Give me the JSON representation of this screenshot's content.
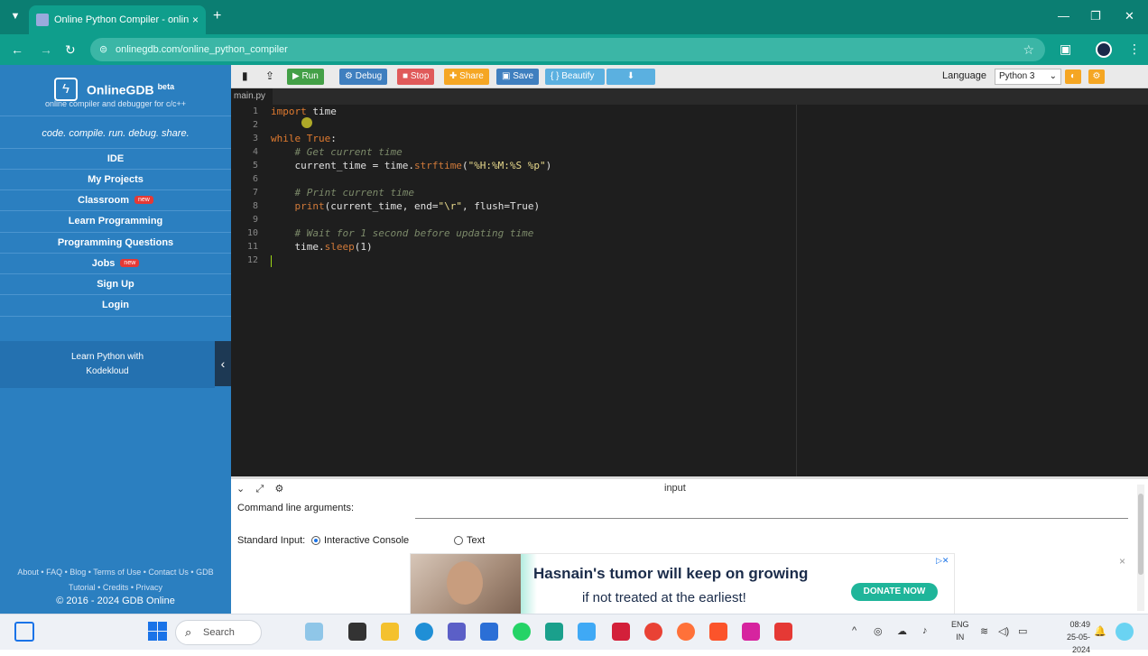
{
  "browser": {
    "tab_title": "Online Python Compiler - onlin",
    "tab_close": "×",
    "new_tab": "+",
    "url": "onlinegdb.com/online_python_compiler",
    "window_controls": [
      "—",
      "❐",
      "✕"
    ]
  },
  "sidebar": {
    "brand_name": "OnlineGDB",
    "brand_sup": "beta",
    "tagline": "online compiler and debugger for c/c++",
    "motto": "code. compile. run. debug. share.",
    "nav": [
      {
        "label": "IDE",
        "new": false
      },
      {
        "label": "My Projects",
        "new": false
      },
      {
        "label": "Classroom",
        "new": true
      },
      {
        "label": "Learn Programming",
        "new": false
      },
      {
        "label": "Programming Questions",
        "new": false
      },
      {
        "label": "Jobs",
        "new": true
      },
      {
        "label": "Sign Up",
        "new": false
      },
      {
        "label": "Login",
        "new": false
      }
    ],
    "new_badge": "new",
    "promo_line1": "Learn Python with",
    "promo_line2": "Kodekloud",
    "footer_line1": "About • FAQ • Blog • Terms of Use • Contact Us • GDB",
    "footer_line2": "Tutorial • Credits • Privacy",
    "copyright": "© 2016 - 2024 GDB Online"
  },
  "toolbar": {
    "run": "Run",
    "debug": "Debug",
    "stop": "Stop",
    "share": "Share",
    "save": "Save",
    "beautify": "{ } Beautify",
    "language_label": "Language",
    "language_value": "Python 3",
    "colors": {
      "run": "#43a047",
      "debug": "#3f7fbf",
      "stop": "#e05a5a",
      "share": "#f5a623",
      "save": "#3f7fbf",
      "beautify": "#5bb0e0",
      "download": "#5bb0e0"
    }
  },
  "editor": {
    "filename": "main.py",
    "line_numbers": [
      "1",
      "2",
      "3",
      "4",
      "5",
      "6",
      "7",
      "8",
      "9",
      "10",
      "11",
      "12"
    ],
    "lines": [
      {
        "k": "import",
        "r": " time"
      },
      {
        "r": ""
      },
      {
        "k": "while",
        "r": " ",
        "c": "True",
        "e": ":"
      },
      {
        "cm": "    # Get current time"
      },
      {
        "r": "    current_time = time.",
        "f": "strftime",
        "e": "(",
        "s": "\"%H:%M:%S %p\"",
        "z": ")"
      },
      {
        "r": ""
      },
      {
        "cm": "    # Print current time"
      },
      {
        "r": "    ",
        "f": "print",
        "e": "(current_time, end=",
        "s": "\"\\r\"",
        "z": ", flush=True)"
      },
      {
        "r": ""
      },
      {
        "cm": "    # Wait for 1 second before updating time"
      },
      {
        "r": "    time.",
        "f": "sleep",
        "e": "(1)"
      },
      {
        "r": ""
      }
    ]
  },
  "input_panel": {
    "title": "input",
    "cmd_label": "Command line arguments:",
    "std_label": "Standard Input:",
    "opt_interactive": "Interactive Console",
    "opt_text": "Text"
  },
  "ad": {
    "headline": "Hasnain's tumor will keep on growing",
    "subline": "if not treated at the earliest!",
    "button": "DONATE NOW",
    "close": "×"
  },
  "taskbar": {
    "search_placeholder": "Search",
    "lang_line1": "ENG",
    "lang_line2": "IN",
    "time": "08:49",
    "date": "25-05-2024"
  }
}
